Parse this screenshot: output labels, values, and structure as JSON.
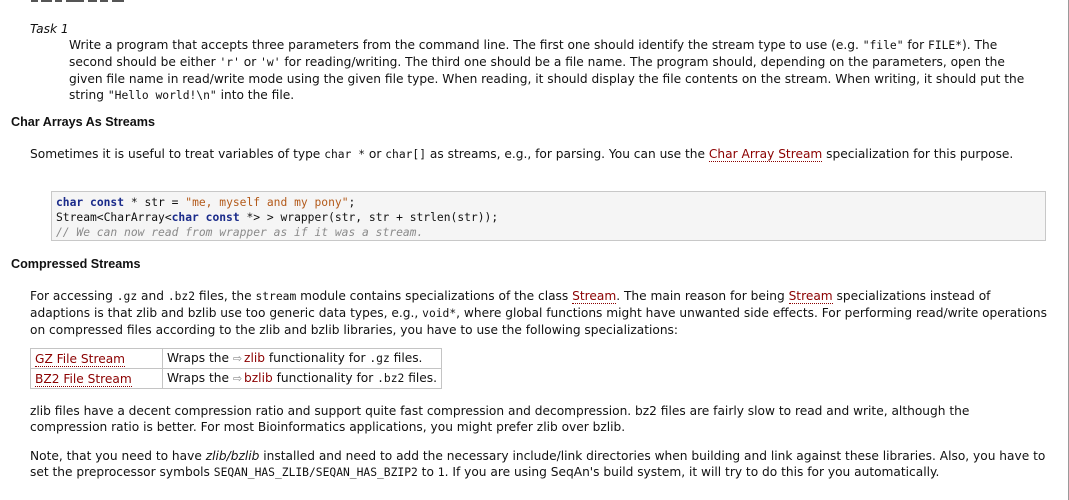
{
  "task": {
    "label": "Task 1",
    "t1": "Write a program that accepts three parameters from the command line. The first one should identify the stream type to use (e.g. ",
    "c1": "\"file\"",
    "t2": " for ",
    "c2": "FILE*",
    "t3": "). The second should be either ",
    "c3": "'r'",
    "t4": " or ",
    "c4": "'w'",
    "t5": " for reading/writing. The third one should be a file name. The program should, depending on the parameters, open the given file name in read/write mode using the given file type. When reading, it should display the file contents on the stream. When writing, it should put the string ",
    "c5": "\"Hello world!\\n\"",
    "t6": " into the file."
  },
  "char_section": {
    "heading": "Char Arrays As Streams",
    "t1": "Sometimes it is useful to treat variables of type ",
    "c1": "char *",
    "t2": " or ",
    "c2": "char[]",
    "t3": " as streams, e.g., for parsing. You can use the ",
    "link": "Char Array Stream",
    "t4": " specialization for this purpose."
  },
  "code": {
    "l1_kw1": "char",
    "l1_kw2": "const",
    "l1_mid": " * str = ",
    "l1_str": "\"me, myself and my pony\"",
    "l1_end": ";",
    "l2_a": "Stream<CharArray<",
    "l2_kw1": "char",
    "l2_kw2": "const",
    "l2_b": " *> > wrapper(str, str + strlen(str));",
    "l3_comment": "// We can now read from wrapper as if it was a stream."
  },
  "compressed_section": {
    "heading": "Compressed Streams",
    "t1": "For accessing ",
    "c1": ".gz",
    "t2": " and ",
    "c2": ".bz2",
    "t3": " files, the ",
    "c3": "stream",
    "t4": " module contains specializations of the class ",
    "link1": "Stream",
    "t5": ". The main reason for being ",
    "link2": "Stream",
    "t6": " specializations instead of adaptions is that zlib and bzlib use too generic data types, e.g., ",
    "c4": "void*",
    "t7": ", where global functions might have unwanted side effects. For performing read/write operations on compressed files according to the zlib and bzlib libraries, you have to use the following specializations:"
  },
  "spec_table": {
    "rows": [
      {
        "name": "GZ File Stream",
        "pre": "Wraps the ",
        "lib": "zlib",
        "mid": " functionality for ",
        "ext": ".gz",
        "post": " files."
      },
      {
        "name": "BZ2 File Stream",
        "pre": "Wraps the ",
        "lib": "bzlib",
        "mid": " functionality for ",
        "ext": ".bz2",
        "post": " files."
      }
    ]
  },
  "ratio_para": {
    "text": "zlib files have a decent compression ratio and support quite fast compression and decompression. bz2 files are fairly slow to read and write, although the compression ratio is better. For most Bioinformatics applications, you might prefer zlib over bzlib."
  },
  "note_para": {
    "t1": "Note, that you need to have ",
    "em": "zlib/bzlib",
    "t2": " installed and need to add the necessary include/link directories when building and link against these libraries. Also, you have to set the preprocessor symbols ",
    "c1": "SEQAN_HAS_ZLIB/SEQAN_HAS_BZIP2",
    "t3": " to ",
    "c2": "1",
    "t4": ". If you are using SeqAn's build system, it will try to do this for you automatically."
  }
}
